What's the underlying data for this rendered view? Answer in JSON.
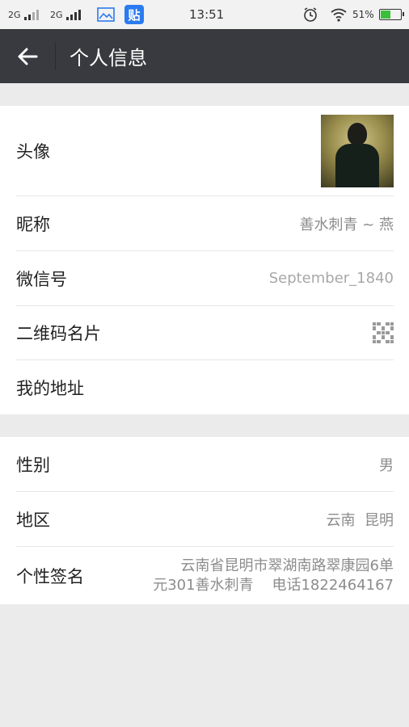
{
  "status_bar": {
    "network1": "2G",
    "network2": "2G",
    "app_icon_text": "贴",
    "time": "13:51",
    "battery_percent": "51%",
    "battery_level": 0.51
  },
  "header": {
    "title": "个人信息",
    "back_icon": "arrow-left-icon"
  },
  "section1": {
    "avatar_label": "头像",
    "nickname_label": "昵称",
    "nickname_value": "善水刺青 ~ 燕",
    "wechat_id_label": "微信号",
    "wechat_id_value": "September_1840",
    "qrcode_label": "二维码名片",
    "qrcode_icon": "qr-code-icon",
    "address_label": "我的地址"
  },
  "section2": {
    "gender_label": "性别",
    "gender_value": "男",
    "region_label": "地区",
    "region_value": "云南  昆明",
    "signature_label": "个性签名",
    "signature_line1": "云南省昆明市翠湖南路翠康园6单",
    "signature_line2": "元301善水刺青    电话1822464167"
  },
  "colors": {
    "header_bg": "#393a3f",
    "page_bg": "#ebebeb",
    "battery_fill": "#3bbf3b",
    "tieba_blue": "#2b7bf0"
  }
}
